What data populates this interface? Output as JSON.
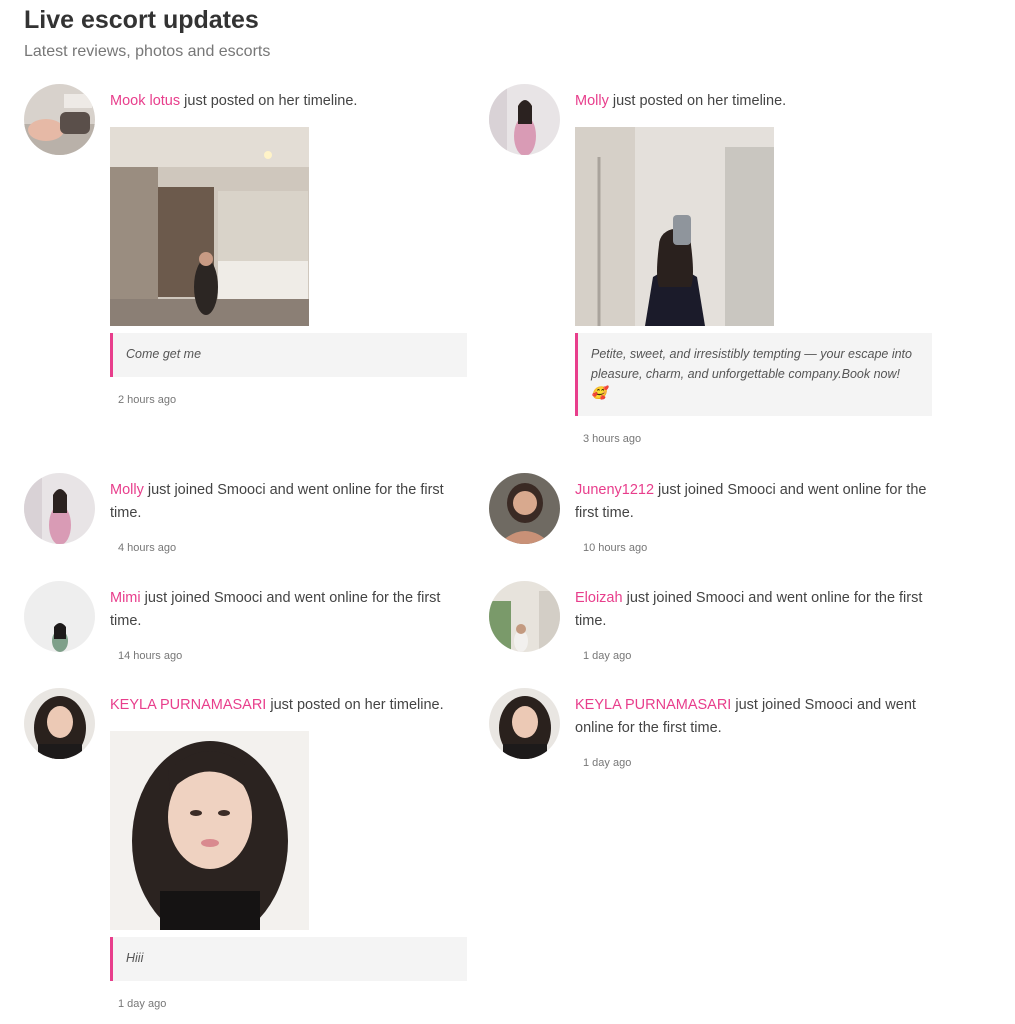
{
  "header": {
    "title": "Live escort updates",
    "subtitle": "Latest reviews, photos and escorts"
  },
  "colors": {
    "accent": "#e83e8c",
    "quote_bg": "#f4f4f4",
    "text": "#444444"
  },
  "feed": [
    {
      "name": "Mook lotus",
      "action": " just posted on her timeline.",
      "quote": "Come get me",
      "time": "2 hours ago"
    },
    {
      "name": "Molly",
      "action": " just posted on her timeline.",
      "quote": "Petite, sweet, and irresistibly tempting — your escape into pleasure, charm, and unforgettable company.Book now! 🥰",
      "time": "3 hours ago"
    },
    {
      "name": "Molly",
      "action": " just joined Smooci and went online for the first time.",
      "time": "4 hours ago"
    },
    {
      "name": "Juneny1212",
      "action": " just joined Smooci and went online for the first time.",
      "time": "10 hours ago"
    },
    {
      "name": "Mimi",
      "action": " just joined Smooci and went online for the first time.",
      "time": "14 hours ago"
    },
    {
      "name": "Eloizah",
      "action": " just joined Smooci and went online for the first time.",
      "time": "1 day ago"
    },
    {
      "name": "KEYLA PURNAMASARI",
      "action": " just posted on her timeline.",
      "quote": "Hiii",
      "time": "1 day ago"
    },
    {
      "name": "KEYLA PURNAMASARI",
      "action": " just joined Smooci and went online for the first time.",
      "time": "1 day ago"
    }
  ]
}
